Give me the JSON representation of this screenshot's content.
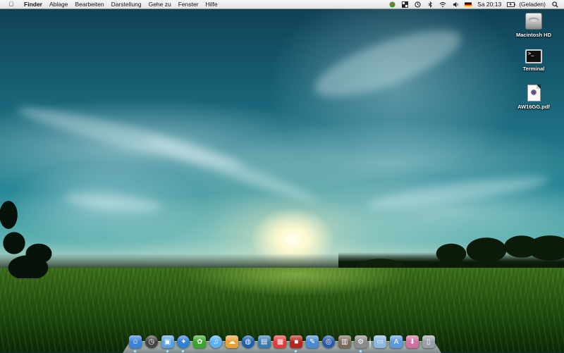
{
  "menubar": {
    "apple_icon": "apple-logo-icon",
    "app_name": "Finder",
    "items": [
      "Ablage",
      "Bearbeiten",
      "Darstellung",
      "Gehe zu",
      "Fenster",
      "Hilfe"
    ],
    "status_icons": [
      "frog-icon",
      "grid-icon",
      "time-machine-icon",
      "bluetooth-icon",
      "wifi-icon",
      "volume-icon",
      "german-flag-icon"
    ],
    "clock": "Sa 20:13",
    "battery_status": "(Geladen)",
    "spotlight_icon": "spotlight-search-icon"
  },
  "desktop": {
    "icons": [
      {
        "label": "Macintosh HD",
        "icon": "hard-drive-icon"
      },
      {
        "label": "Terminal",
        "icon": "terminal-icon"
      },
      {
        "label": "AW16GG.pdf",
        "icon": "pdf-document-icon"
      }
    ]
  },
  "dock": {
    "apps": [
      {
        "icon": "finder-icon",
        "color": "#3b82d6"
      },
      {
        "icon": "dashboard-icon",
        "color": "#444444"
      },
      {
        "icon": "preview-icon",
        "color": "#5aa0e0"
      },
      {
        "icon": "safari-icon",
        "color": "#2f7fd8"
      },
      {
        "icon": "icq-flower-icon",
        "color": "#3aa52a"
      },
      {
        "icon": "itunes-icon",
        "color": "#5ab0f0"
      },
      {
        "icon": "weather-icon",
        "color": "#e8a23a"
      },
      {
        "icon": "globe-icon",
        "color": "#1c5fb0"
      },
      {
        "icon": "iphoto-icon",
        "color": "#3a7ab0"
      },
      {
        "icon": "ical-icon",
        "color": "#e23b3b"
      },
      {
        "icon": "red-app-icon",
        "color": "#b5281f"
      },
      {
        "icon": "xcode-icon",
        "color": "#4a8ad0"
      },
      {
        "icon": "network-globe-icon",
        "color": "#2a5aa8"
      },
      {
        "icon": "photo-booth-icon",
        "color": "#7a6a58"
      },
      {
        "icon": "system-preferences-icon",
        "color": "#8a8a8a"
      }
    ],
    "stacks": [
      {
        "icon": "folder-icon",
        "color": "#8ab8e0"
      },
      {
        "icon": "applications-folder-icon",
        "color": "#5a9ae0"
      },
      {
        "icon": "downloads-stack-icon",
        "color": "#d070a0"
      },
      {
        "icon": "trash-icon",
        "color": "#9aa0a8"
      }
    ]
  }
}
